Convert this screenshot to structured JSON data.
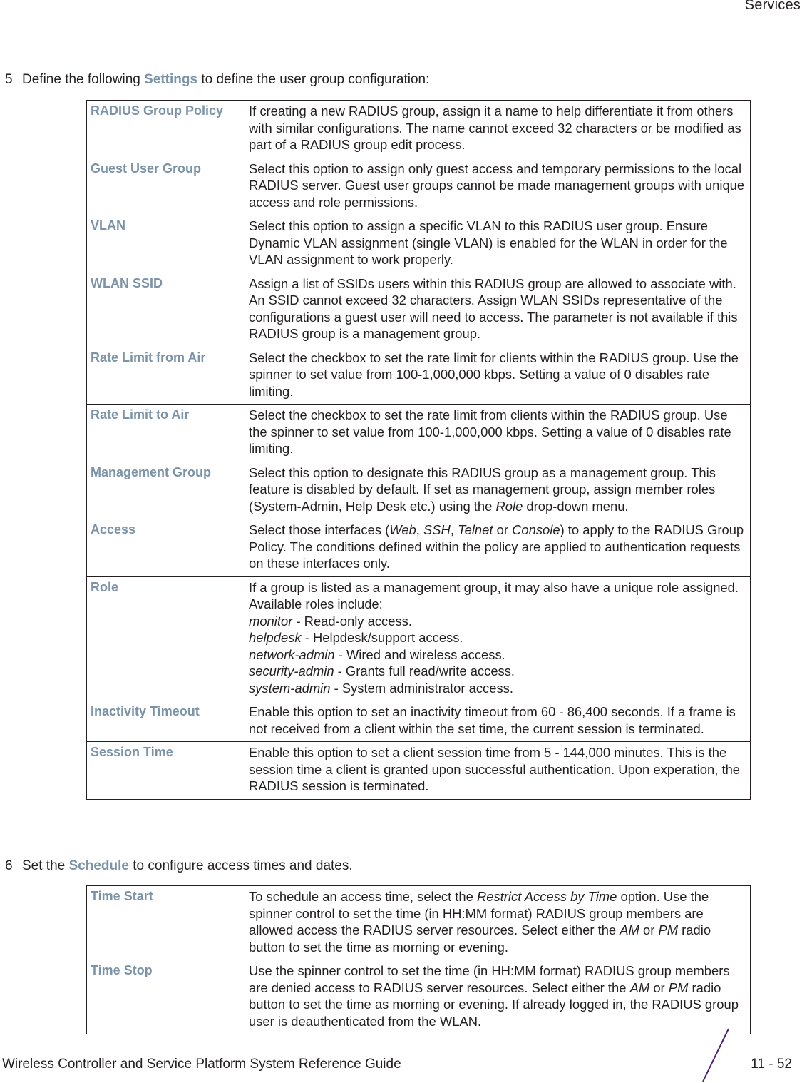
{
  "header": {
    "section": "Services"
  },
  "step5": {
    "number": "5",
    "before": "Define the following ",
    "highlight": "Settings",
    "after": " to define the user group configuration:"
  },
  "settings_table": [
    {
      "name": "RADIUS Group Policy",
      "desc": "If creating a new RADIUS group, assign it a name to help differentiate it from others with similar configurations. The name cannot exceed 32 characters or be modified as part of a RADIUS group edit process."
    },
    {
      "name": "Guest User Group",
      "desc": "Select this option to assign only guest access and temporary permissions to the local RADIUS server. Guest user groups cannot be made management groups with unique access and role permissions."
    },
    {
      "name": "VLAN",
      "desc": "Select this option to assign a specific VLAN to this RADIUS user group. Ensure Dynamic VLAN assignment (single VLAN) is enabled for the WLAN in order for the VLAN assignment to work properly."
    },
    {
      "name": "WLAN SSID",
      "desc": "Assign a list of SSIDs users within this RADIUS group are allowed to associate with. An SSID cannot exceed 32 characters. Assign WLAN SSIDs representative of the configurations a guest user will need to access. The parameter is not available if this RADIUS group is a management group."
    },
    {
      "name": "Rate Limit from Air",
      "desc": "Select the checkbox to set the rate limit for clients within the RADIUS group. Use the spinner to set value from 100-1,000,000 kbps. Setting a value of 0 disables rate limiting."
    },
    {
      "name": "Rate Limit to Air",
      "desc": "Select the checkbox to set the rate limit from clients within the RADIUS group. Use the spinner to set value from 100-1,000,000 kbps. Setting a value of 0 disables rate limiting."
    },
    {
      "name": "Management Group",
      "desc_parts": [
        "Select this option to designate this RADIUS group as a management group. This feature is disabled by default. If set as management group, assign member roles (System-Admin, Help Desk etc.) using the ",
        "Role",
        " drop-down menu."
      ]
    },
    {
      "name": "Access",
      "desc_parts": [
        "Select those interfaces (",
        "Web",
        ", ",
        "SSH",
        ", ",
        "Telnet",
        " or ",
        "Console",
        ") to apply to the RADIUS Group Policy. The conditions defined within the policy are applied to authentication requests on these interfaces only."
      ]
    },
    {
      "name": "Role",
      "intro": "If a group is listed as a management group, it may also have a unique role assigned. Available roles include:",
      "roles": [
        {
          "role": "monitor",
          "text": " - Read-only access."
        },
        {
          "role": "helpdesk",
          "text": " - Helpdesk/support access."
        },
        {
          "role": "network-admin",
          "text": " - Wired and wireless access."
        },
        {
          "role": "security-admin",
          "text": " - Grants full read/write access."
        },
        {
          "role": "system-admin",
          "text": " - System administrator access."
        }
      ]
    },
    {
      "name": "Inactivity Timeout",
      "desc": "Enable this option to set an inactivity timeout from 60 - 86,400 seconds. If a frame is not received from a client within the set time, the current session is terminated."
    },
    {
      "name": "Session Time",
      "desc": "Enable this option to set a client session time from 5 - 144,000 minutes. This is the session time a client is granted upon successful authentication. Upon experation, the RADIUS session is terminated."
    }
  ],
  "step6": {
    "number": "6",
    "before": "Set the ",
    "highlight": "Schedule",
    "after": " to configure access times and dates."
  },
  "schedule_table": [
    {
      "name": "Time Start",
      "desc_parts": [
        "To schedule an access time, select the ",
        "Restrict Access by Time",
        " option. Use the spinner control to set the time (in HH:MM format) RADIUS group members are allowed access the RADIUS server resources. Select either the ",
        "AM",
        " or ",
        "PM",
        " radio button to set the time as morning or evening."
      ]
    },
    {
      "name": "Time Stop",
      "desc_parts": [
        "Use the spinner control to set the time (in HH:MM format) RADIUS group members are denied access to RADIUS server resources. Select either the ",
        "AM",
        " or ",
        "PM",
        " radio button to set the time as morning or evening. If already logged in, the RADIUS group user is deauthenticated from the WLAN."
      ]
    }
  ],
  "footer": {
    "guide_title": "Wireless Controller and Service Platform System Reference Guide",
    "page_number": "11 - 52"
  },
  "colors": {
    "accent": "#7b93a8",
    "rule": "#4b1f78",
    "text": "#231f20"
  }
}
